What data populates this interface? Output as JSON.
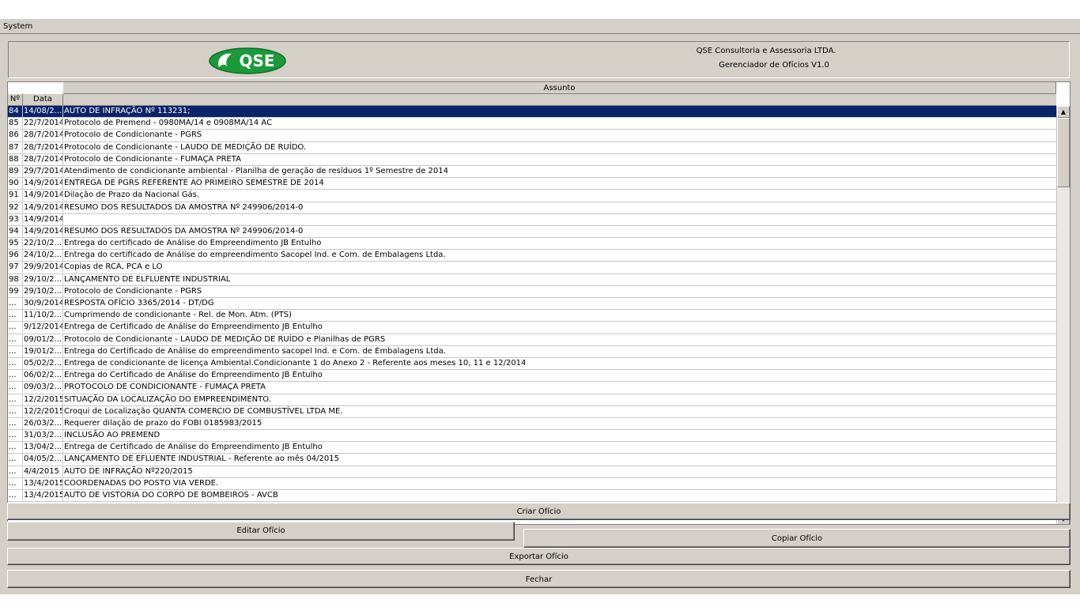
{
  "menu": {
    "system_label": "System"
  },
  "header": {
    "logo_text": "QSE",
    "company_name": "QSE Consultoria e Assessoria LTDA.",
    "app_version": "Gerenciador de Ofícios V1.0"
  },
  "table": {
    "columns": {
      "num": "Nº",
      "date": "Data",
      "assunto": "Assunto"
    },
    "rows": [
      {
        "num": "84",
        "date": "14/08/2...",
        "assunto": "AUTO DE INFRAÇÃO Nº 113231;",
        "selected": true
      },
      {
        "num": "85",
        "date": "22/7/2014",
        "assunto": "Protocolo de Premend - 0980MA/14 e 0908MA/14 AC"
      },
      {
        "num": "86",
        "date": "28/7/2014",
        "assunto": "Protocolo de Condicionante - PGRS"
      },
      {
        "num": "87",
        "date": "28/7/2014",
        "assunto": "Protocolo de Condicionante - LAUDO DE MEDIÇÃO DE RUÍDO."
      },
      {
        "num": "88",
        "date": "28/7/2014",
        "assunto": "Protocolo de Condicionante - FUMAÇA PRETA"
      },
      {
        "num": "89",
        "date": "29/7/2014",
        "assunto": "Atendimento de condicionante ambiental - Planilha de geração de resíduos 1º Semestre de 2014"
      },
      {
        "num": "90",
        "date": "14/9/2014",
        "assunto": "ENTREGA DE PGRS REFERENTE AO PRIMEIRO SEMESTRE DE 2014"
      },
      {
        "num": "91",
        "date": "14/9/2014",
        "assunto": "Dilação de Prazo da Nacional Gás."
      },
      {
        "num": "92",
        "date": "14/9/2014",
        "assunto": "RESUMO DOS RESULTADOS DA AMOSTRA Nº 249906/2014-0"
      },
      {
        "num": "93",
        "date": "14/9/2014",
        "assunto": ""
      },
      {
        "num": "94",
        "date": "14/9/2014",
        "assunto": "RESUMO DOS RESULTADOS DA AMOSTRA Nº 249906/2014-0"
      },
      {
        "num": "95",
        "date": "22/10/2...",
        "assunto": "Entrega do certificado de Análise do Empreendimento JB Entulho"
      },
      {
        "num": "96",
        "date": "24/10/2...",
        "assunto": "Entrega do certificado de Análise do empreendimento Sacopel Ind. e Com. de Embalagens Ltda."
      },
      {
        "num": "97",
        "date": "29/9/2014",
        "assunto": "Copias de RCA, PCA e LO"
      },
      {
        "num": "98",
        "date": "29/10/2...",
        "assunto": "LANÇAMENTO DE ELFLUENTE INDUSTRIAL"
      },
      {
        "num": "99",
        "date": "29/10/2...",
        "assunto": "Protocolo de Condicionante - PGRS"
      },
      {
        "num": "...",
        "date": "30/9/2014",
        "assunto": "RESPOSTA OFÍCIO 3365/2014 - DT/DG"
      },
      {
        "num": "...",
        "date": "11/10/2...",
        "assunto": "Cumprimendo de condicionante - Rel. de Mon. Atm. (PTS)"
      },
      {
        "num": "...",
        "date": "9/12/2014",
        "assunto": "Entrega de Certificado de Análise do Empreendimento JB Entulho"
      },
      {
        "num": "...",
        "date": "09/01/2...",
        "assunto": "Protocolo de Condicionante - LAUDO DE MEDIÇÃO DE RUÍDO e Planilhas de PGRS"
      },
      {
        "num": "...",
        "date": "19/01/2...",
        "assunto": "Entrega do Certificado de Análise do empreendimento sacopel Ind. e Com. de Embalagens Ltda."
      },
      {
        "num": "...",
        "date": "05/02/2...",
        "assunto": "Entrega de condicionante de licença Ambiental.Condicionante 1 do Anexo 2 - Referente aos meses 10, 11 e 12/2014"
      },
      {
        "num": "...",
        "date": "06/02/2...",
        "assunto": "Entrega do Certificado de Análise do Empreendimento JB Entulho"
      },
      {
        "num": "...",
        "date": "09/03/2...",
        "assunto": "PROTOCOLO DE CONDICIONANTE - FUMAÇA PRETA"
      },
      {
        "num": "...",
        "date": "12/2/2015",
        "assunto": "SITUAÇÃO DA LOCALIZAÇÃO DO EMPREENDIMENTO."
      },
      {
        "num": "...",
        "date": "12/2/2015",
        "assunto": "Croqui de Localização QUANTA COMERCIO DE COMBUSTÍVEL LTDA ME."
      },
      {
        "num": "...",
        "date": "26/03/2...",
        "assunto": "Requerer dilação de prazo do FOBI  0185983/2015"
      },
      {
        "num": "...",
        "date": "31/03/2...",
        "assunto": "INCLUSÃO AO PREMEND"
      },
      {
        "num": "...",
        "date": "13/04/2...",
        "assunto": "Entrega de Certificado de Análise do Empreendimento JB Entulho"
      },
      {
        "num": "...",
        "date": "04/05/2...",
        "assunto": "LANÇAMENTO DE EFLUENTE INDUSTRIAL - Referente ao mês 04/2015"
      },
      {
        "num": "...",
        "date": "4/4/2015",
        "assunto": "AUTO DE INFRAÇÃO Nº220/2015"
      },
      {
        "num": "...",
        "date": "13/4/2015",
        "assunto": "COORDENADAS DO POSTO VIA VERDE."
      },
      {
        "num": "...",
        "date": "13/4/2015",
        "assunto": "AUTO DE VISTORIA DO CORPO DE BOMBEIROS - AVCB"
      }
    ]
  },
  "buttons": {
    "criar": "Criar Ofício",
    "editar": "Editar Ofício",
    "copiar": "Copiar Ofício",
    "exportar": "Exportar Ofício",
    "fechar": "Fechar"
  },
  "colors": {
    "selection": "#0a246a",
    "window_bg": "#d4d0c8",
    "logo_green": "#1a9a3a"
  }
}
